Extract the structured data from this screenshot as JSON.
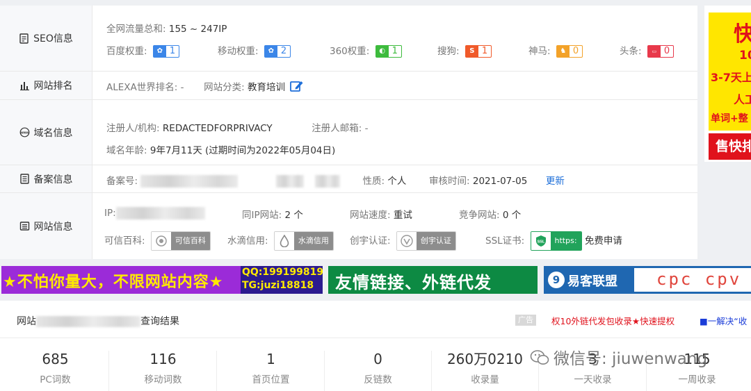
{
  "seo": {
    "label": "SEO信息",
    "traffic_label": "全网流量总和:",
    "traffic_value": "155 ~ 247IP",
    "weights": [
      {
        "label": "百度权重:",
        "value": "1",
        "color": "#3b86e8",
        "icon": "paw-icon"
      },
      {
        "label": "移动权重:",
        "value": "2",
        "color": "#3b86e8",
        "icon": "paw-icon"
      },
      {
        "label": "360权重:",
        "value": "1",
        "color": "#3dbb3d",
        "icon": "360-icon"
      },
      {
        "label": "搜狗:",
        "value": "1",
        "color": "#f05a2a",
        "icon": "sogou-icon"
      },
      {
        "label": "神马:",
        "value": "0",
        "color": "#f3a229",
        "icon": "shenma-icon"
      },
      {
        "label": "头条:",
        "value": "0",
        "color": "#e8394b",
        "icon": "toutiao-icon"
      }
    ]
  },
  "rank": {
    "label": "网站排名",
    "alexa_label": "ALEXA世界排名:",
    "alexa_value": "-",
    "category_label": "网站分类:",
    "category_value": "教育培训"
  },
  "domain": {
    "label": "域名信息",
    "registrant_label": "注册人/机构:",
    "registrant_value": "REDACTEDFORPRIVACY",
    "email_label": "注册人邮箱:",
    "email_value": "-",
    "age_label": "域名年龄:",
    "age_value": "9年7月11天",
    "expire_text": "(过期时间为2022年05月04日)"
  },
  "icp": {
    "label": "备案信息",
    "number_label": "备案号:",
    "nature_label": "性质:",
    "nature_value": "个人",
    "review_label": "审核时间:",
    "review_value": "2021-07-05",
    "update_link": "更新"
  },
  "site": {
    "label": "网站信息",
    "ip_label": "IP:",
    "same_ip_label": "同IP网站:",
    "same_ip_value": "2 个",
    "speed_label": "网站速度:",
    "speed_value": "重试",
    "compete_label": "竞争网站:",
    "compete_value": "0 个",
    "credit_label": "可信百科:",
    "credit_badge": "可信百科",
    "water_label": "水滴信用:",
    "water_badge": "水滴信用",
    "cy_label": "创宇认证:",
    "cy_badge": "创宇认证",
    "ssl_label": "SSL证书:",
    "ssl_badge": "https:",
    "ssl_link": "免费申请"
  },
  "side_ad": {
    "line1": "快",
    "line2": "10",
    "line3": "3-7天上",
    "line4": "人工",
    "line5": "单词+整",
    "button": "售快排"
  },
  "banners": {
    "b1_text": "★不怕你量大，不限网站内容★",
    "b1_qq": "QQ:199199819",
    "b1_tg": "TG:juzi18818",
    "b2_text": "友情链接、外链代发",
    "b3_logo": "9",
    "b3_text": "易客联盟",
    "b3_cpc": "cpc cpv"
  },
  "results": {
    "title_prefix": "网站",
    "title_suffix": "查询结果",
    "ad_tag": "广告",
    "ad1": "权10外链代发包收录★快速提权",
    "ad2": "■一解决“收",
    "stats": [
      {
        "value": "685",
        "label": "PC词数"
      },
      {
        "value": "116",
        "label": "移动词数"
      },
      {
        "value": "1",
        "label": "首页位置"
      },
      {
        "value": "0",
        "label": "反链数"
      },
      {
        "value": "260万0210",
        "label": "收录量"
      },
      {
        "value": "3",
        "label": "一天收录"
      },
      {
        "value": "115",
        "label": "一周收录"
      }
    ]
  },
  "watermark": "微信号: jiuwenwang"
}
